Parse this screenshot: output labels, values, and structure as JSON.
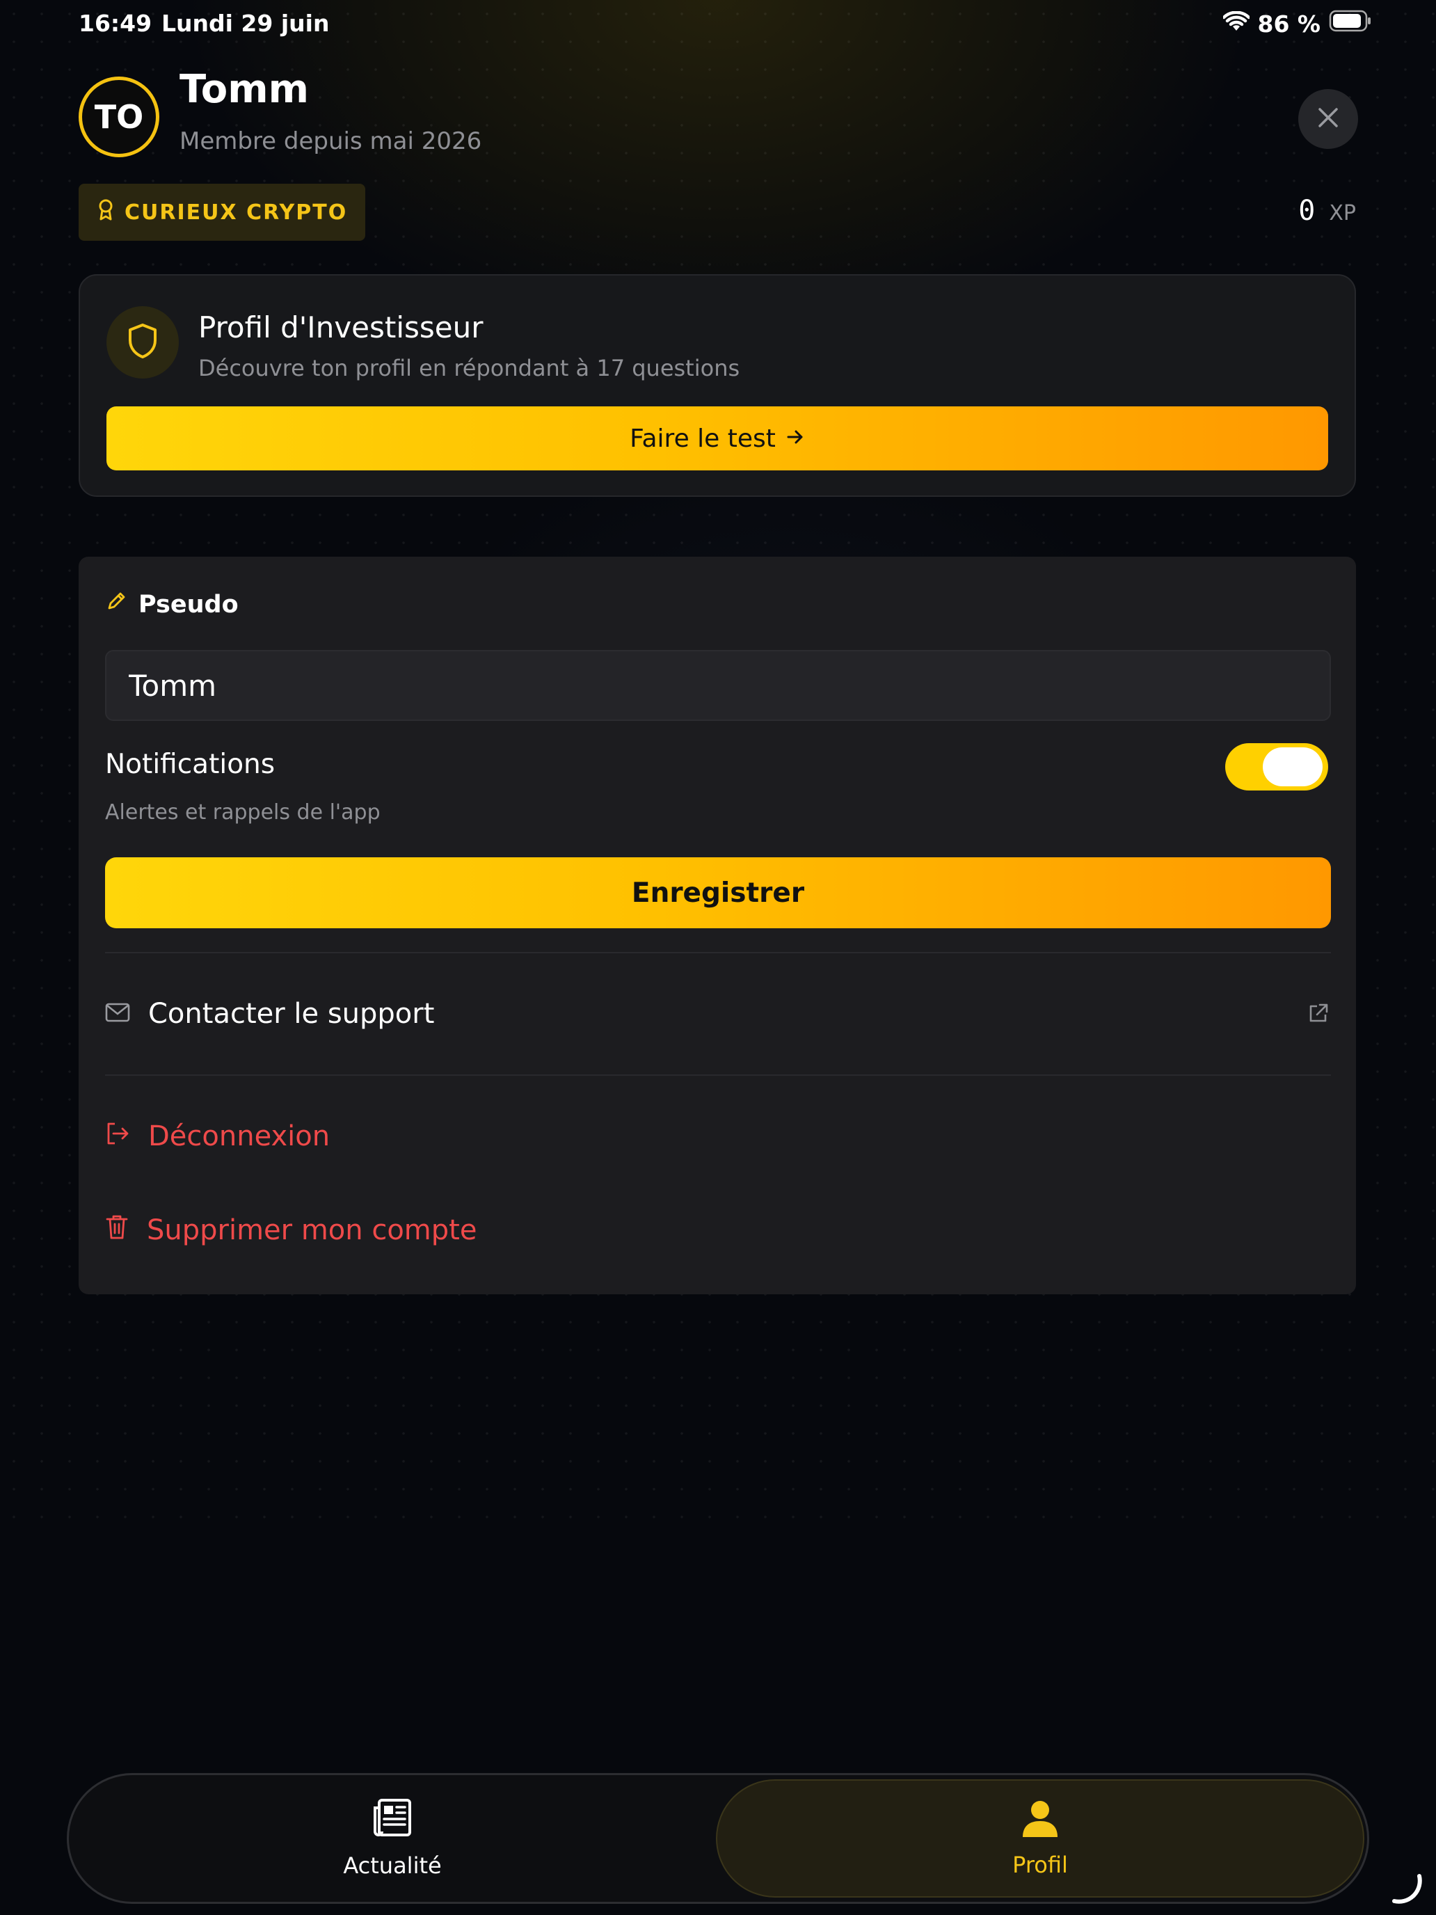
{
  "status_bar": {
    "time": "16:49",
    "date": "Lundi 29 juin",
    "battery": "86 %",
    "icons": [
      "wifi-icon",
      "battery-icon"
    ]
  },
  "header": {
    "avatar_initials": "TO",
    "user_name": "Tomm",
    "member_since": "Membre depuis mai 2026",
    "close_icon": "close-icon"
  },
  "rank": {
    "label": "CURIEUX CRYPTO",
    "icon": "award-icon"
  },
  "xp": {
    "value": "0",
    "unit": "XP"
  },
  "investor_card": {
    "icon": "shield-icon",
    "title": "Profil d'Investisseur",
    "subtitle": "Découvre ton profil en répondant à 17 questions",
    "button_label": "Faire le test"
  },
  "settings": {
    "pseudo_label": "Pseudo",
    "pseudo_value": "Tomm",
    "notifications_title": "Notifications",
    "notifications_subtitle": "Alertes et rappels de l'app",
    "notifications_enabled": true,
    "save_label": "Enregistrer",
    "support_label": "Contacter le support",
    "logout_label": "Déconnexion",
    "delete_label": "Supprimer mon compte"
  },
  "bottom_nav": {
    "items": [
      {
        "label": "Actualité",
        "icon": "newspaper-icon",
        "active": false
      },
      {
        "label": "Profil",
        "icon": "user-icon",
        "active": true
      }
    ]
  },
  "colors": {
    "accent": "#f5c518",
    "danger": "#ef4a4a",
    "gradient_start": "#ffd60a",
    "gradient_end": "#ff9800",
    "background": "#06080d",
    "card": "#1c1c1f"
  }
}
